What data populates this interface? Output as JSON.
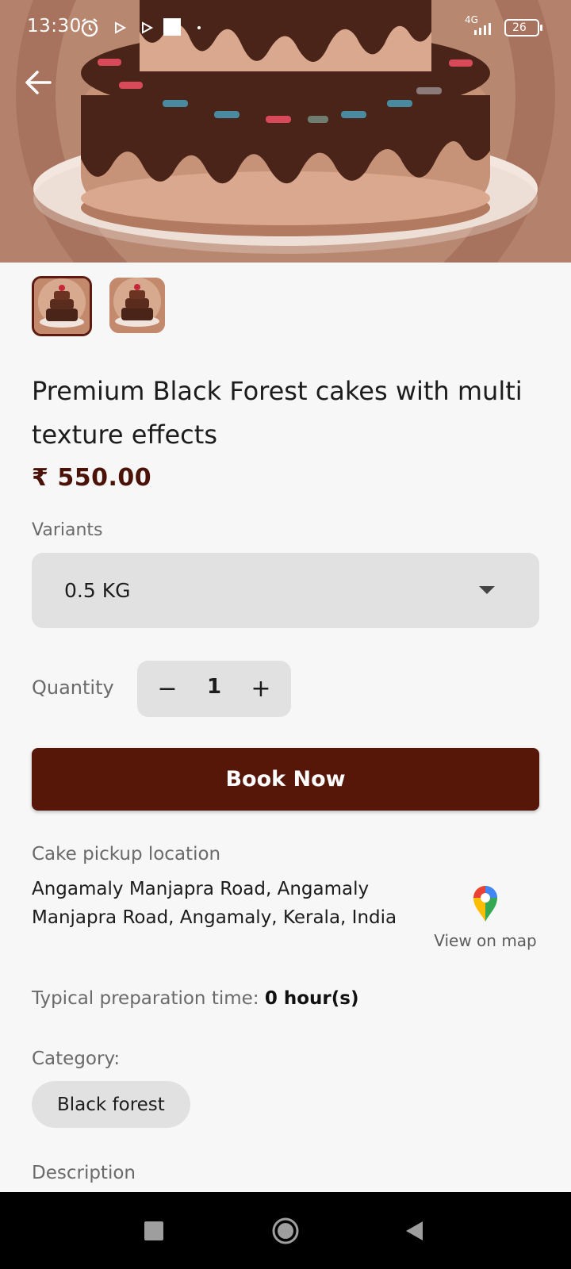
{
  "status_bar": {
    "time": "13:30",
    "network": "4G",
    "battery": "26"
  },
  "product": {
    "title": "Premium Black Forest cakes with multi texture effects",
    "price": "₹ 550.00"
  },
  "variants": {
    "label": "Variants",
    "selected": "0.5 KG"
  },
  "quantity": {
    "label": "Quantity",
    "value": "1",
    "minus": "−",
    "plus": "+"
  },
  "book_button": "Book Now",
  "pickup": {
    "label": "Cake pickup location",
    "address": "Angamaly Manjapra Road, Angamaly Manjapra Road, Angamaly, Kerala, India",
    "map_link": "View on map"
  },
  "preparation": {
    "label": "Typical preparation time:",
    "value": "0 hour(s)"
  },
  "category": {
    "label": "Category:",
    "chip": "Black forest"
  },
  "description": {
    "label": "Description"
  },
  "colors": {
    "accent": "#561608",
    "price": "#4a1208",
    "chip_bg": "#e1e1e1",
    "background": "#f7f7f7"
  },
  "icons": [
    "alarm-icon",
    "play-icon",
    "square-icon",
    "signal-icon",
    "battery-icon",
    "back-arrow-icon",
    "dropdown-caret-icon",
    "map-pin-icon",
    "nav-recents-icon",
    "nav-home-icon",
    "nav-back-icon"
  ]
}
